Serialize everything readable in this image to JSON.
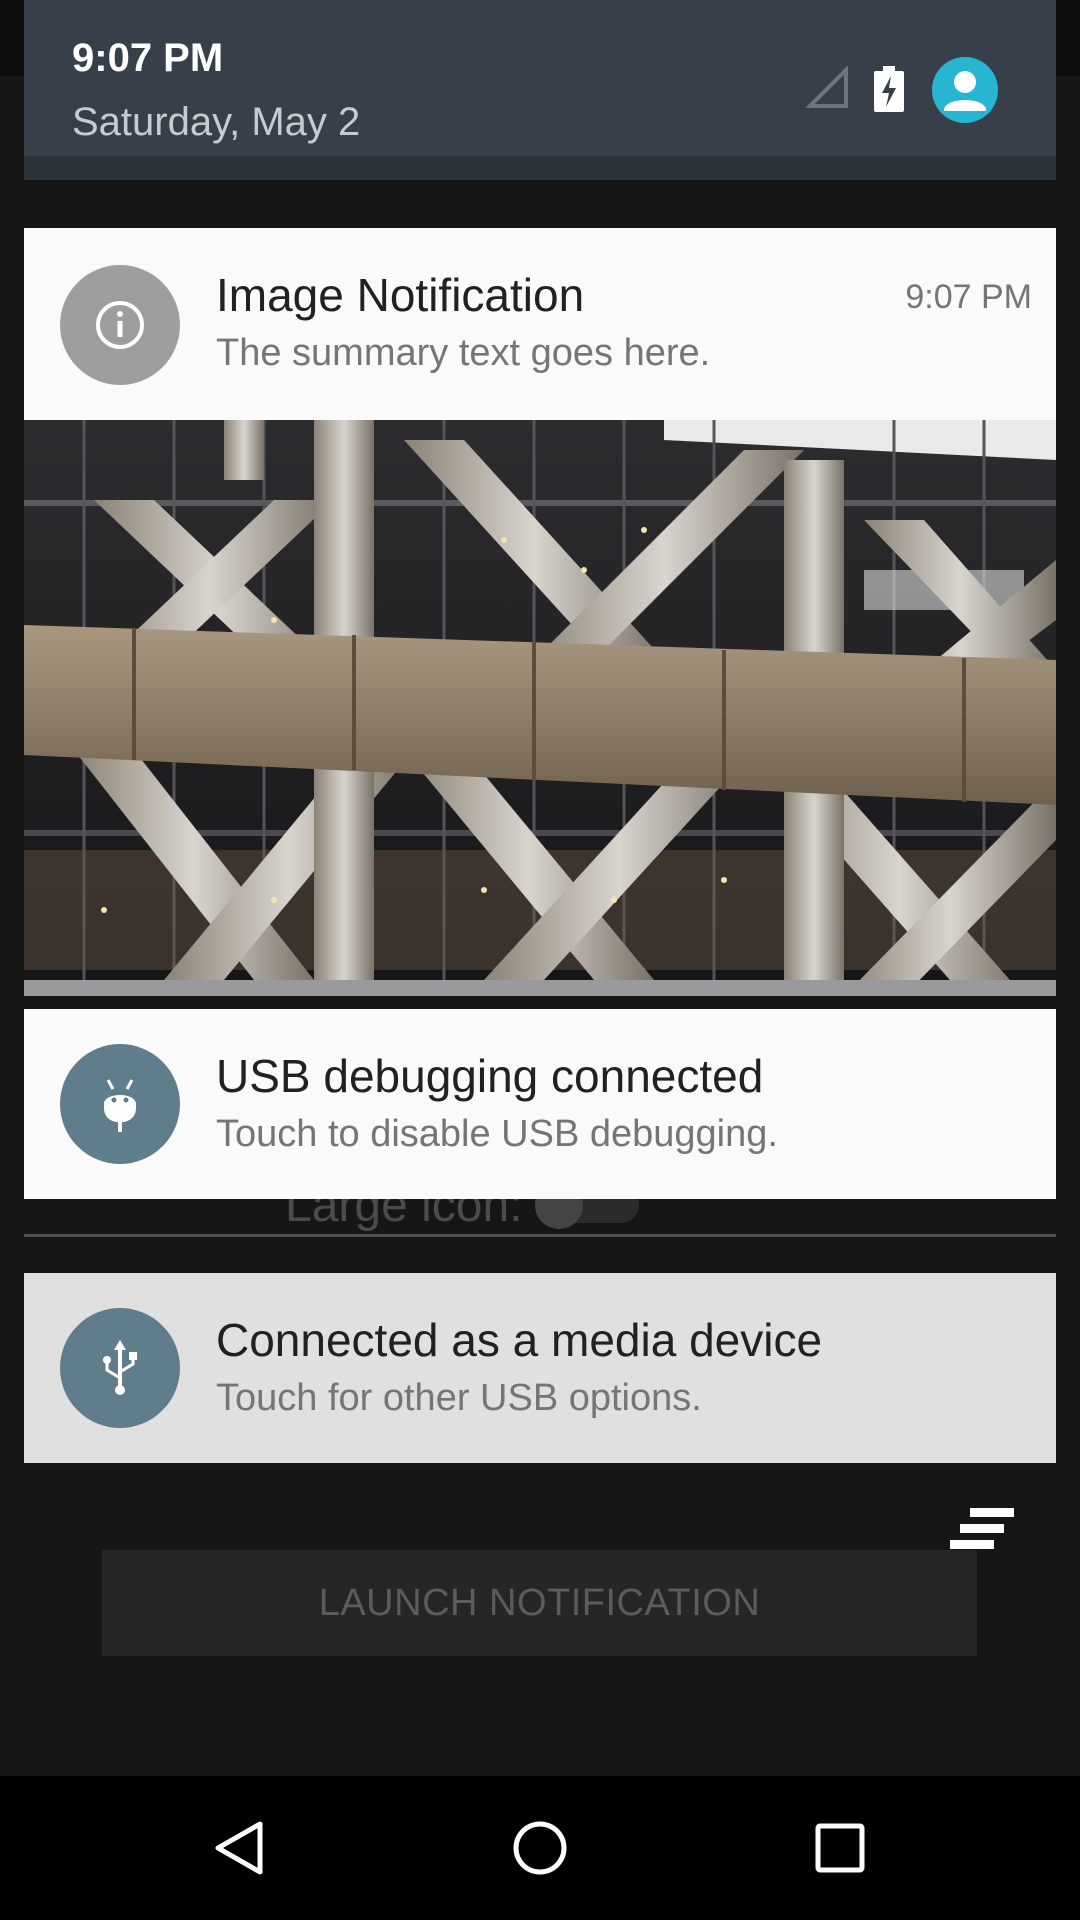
{
  "status_header": {
    "time": "9:07 PM",
    "date": "Saturday, May 2",
    "icons": [
      "signal-icon",
      "battery-charging-icon",
      "user-avatar-icon"
    ],
    "colors": {
      "header_bg": "#37404a",
      "avatar_bg": "#27b5d1"
    }
  },
  "notifications": [
    {
      "icon": "info-icon",
      "title": "Image Notification",
      "summary": "The summary text goes here.",
      "time": "9:07 PM",
      "image": "building-facade-photo"
    },
    {
      "icon": "android-debug-icon",
      "title": "USB debugging connected",
      "summary": "Touch to disable USB debugging."
    },
    {
      "icon": "usb-icon",
      "title": "Connected as a media device",
      "summary": "Touch for other USB options."
    }
  ],
  "app": {
    "large_icon_label": "Large icon:",
    "large_icon_toggle": "off",
    "launch_button": "LAUNCH NOTIFICATION"
  },
  "clear_all": {
    "icon": "clear-all-icon"
  },
  "nav": {
    "icons": [
      "back-icon",
      "home-icon",
      "recents-icon"
    ]
  }
}
